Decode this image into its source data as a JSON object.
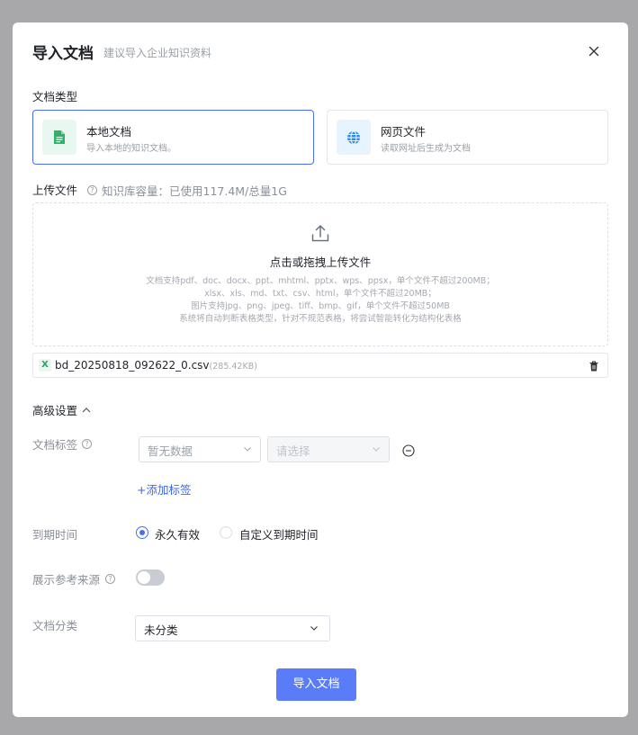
{
  "dialog": {
    "title": "导入文档",
    "subtitle": "建议导入企业知识资料"
  },
  "doc_type": {
    "label": "文档类型",
    "options": [
      {
        "title": "本地文档",
        "desc": "导入本地的知识文档。",
        "icon": "file-icon",
        "selected": true
      },
      {
        "title": "网页文件",
        "desc": "读取网址后生成为文档",
        "icon": "globe-icon",
        "selected": false
      }
    ]
  },
  "upload": {
    "label": "上传文件",
    "capacity": "知识库容量：已使用117.4M/总量1G",
    "drop_title": "点击或拖拽上传文件",
    "notes": [
      "文档支持pdf、doc、docx、ppt、mhtml、pptx、wps、ppsx，单个文件不超过200MB；",
      "xlsx、xls、md、txt、csv、html，单个文件不超过20MB；",
      "图片支持jpg、png、jpeg、tiff、bmp、gif，单个文件不超过50MB",
      "系统将自动判断表格类型，针对不规范表格，将尝试智能转化为结构化表格"
    ],
    "file": {
      "badge": "X",
      "name": "bd_20250818_092622_0.csv",
      "size": "(285.42KB)"
    }
  },
  "advanced": {
    "label": "高级设置",
    "tags": {
      "label": "文档标签",
      "select1_value": "暂无数据",
      "select2_placeholder": "请选择",
      "add_label": "+添加标签"
    },
    "expiry": {
      "label": "到期时间",
      "options": [
        {
          "label": "永久有效",
          "checked": true
        },
        {
          "label": "自定义到期时间",
          "checked": false
        }
      ]
    },
    "show_source": {
      "label": "展示参考来源",
      "enabled": false
    },
    "category": {
      "label": "文档分类",
      "value": "未分类"
    }
  },
  "submit_label": "导入文档",
  "colors": {
    "accent": "#4a6cf7",
    "button": "#5b7cf8",
    "excel_green": "#21a366"
  }
}
